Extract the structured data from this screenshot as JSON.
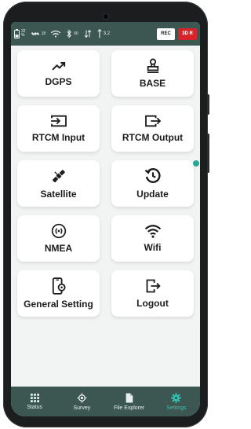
{
  "statusbar": {
    "battery_percent": "32\n%",
    "satellites_count": "18",
    "bluetooth_value": "00",
    "antenna_height": "3.2",
    "rec_label": "REC",
    "mode_label": "3D R"
  },
  "tiles": [
    {
      "label": "DGPS",
      "icon": "trend-up-icon"
    },
    {
      "label": "BASE",
      "icon": "stamp-icon"
    },
    {
      "label": "RTCM Input",
      "icon": "input-icon"
    },
    {
      "label": "RTCM Output",
      "icon": "output-icon"
    },
    {
      "label": "Satellite",
      "icon": "satellite-icon"
    },
    {
      "label": "Update",
      "icon": "update-icon"
    },
    {
      "label": "NMEA",
      "icon": "nmea-icon"
    },
    {
      "label": "Wifi",
      "icon": "wifi-icon"
    },
    {
      "label": "General Setting",
      "icon": "phone-settings-icon"
    },
    {
      "label": "Logout",
      "icon": "logout-icon"
    }
  ],
  "bottomnav": [
    {
      "label": "Status",
      "icon": "grid-icon"
    },
    {
      "label": "Survey",
      "icon": "crosshair-icon"
    },
    {
      "label": "File Explorer",
      "icon": "file-icon"
    },
    {
      "label": "Settings",
      "icon": "gear-icon",
      "active": true
    }
  ],
  "colors": {
    "bar": "#3c5751",
    "accent": "#33c1b2",
    "mode_badge": "#d9232b"
  }
}
